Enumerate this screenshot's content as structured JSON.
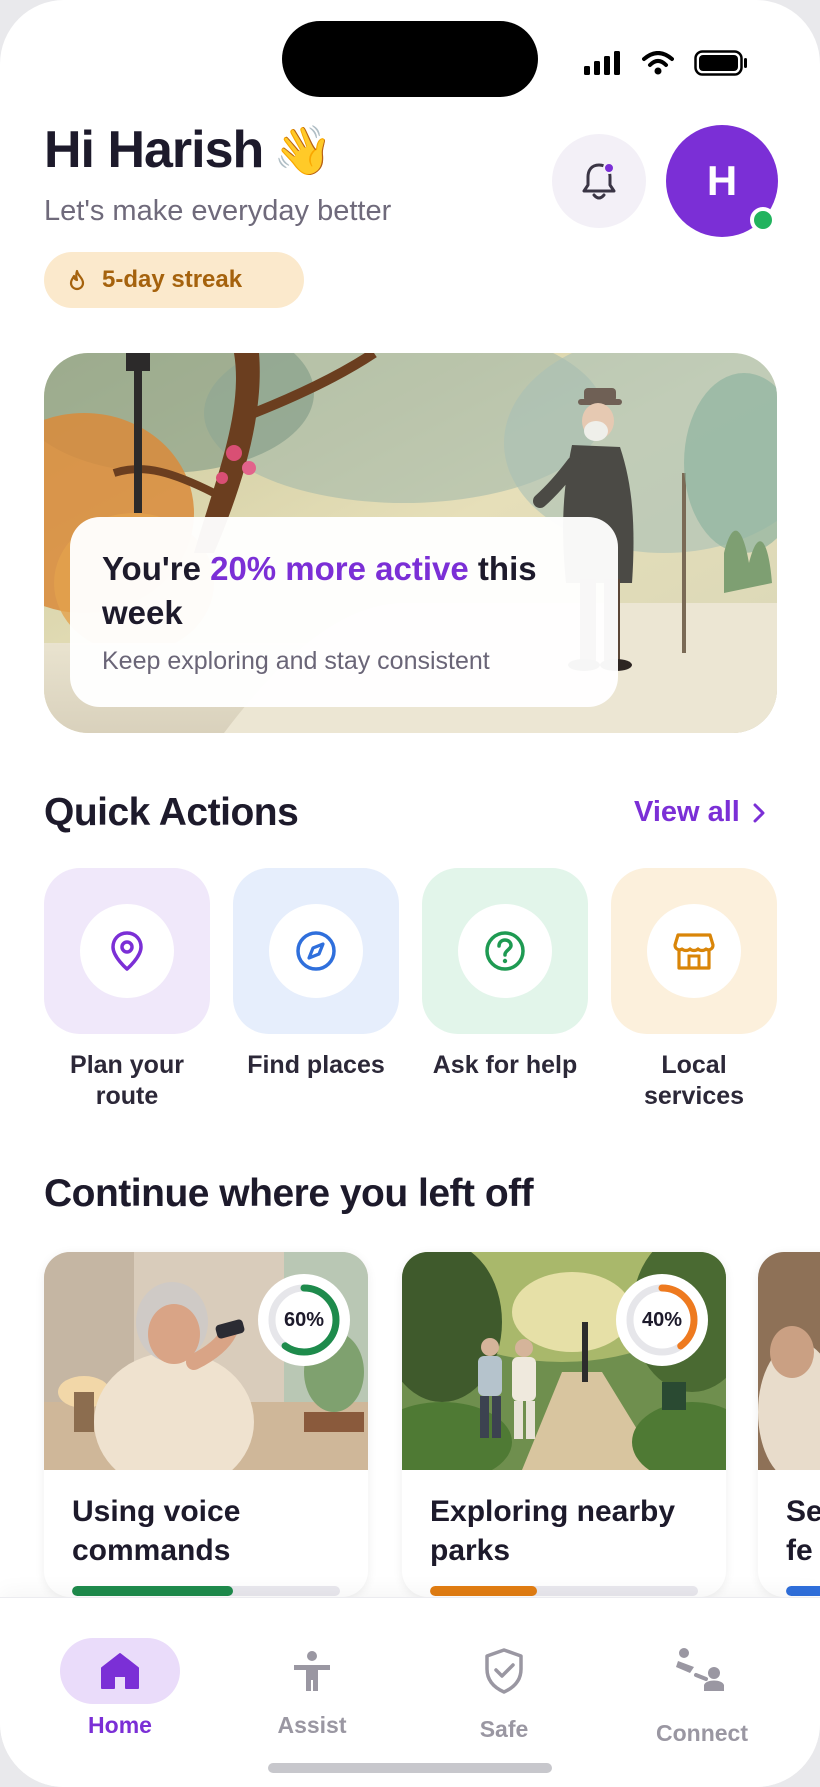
{
  "header": {
    "greeting": "Hi Harish",
    "wave_emoji": "👋",
    "subtitle": "Let's make everyday better",
    "streak_label": "5-day streak",
    "avatar_initial": "H"
  },
  "hero": {
    "title_prefix": "You're ",
    "title_accent": "20% more active",
    "title_suffix": " this week",
    "subtitle": "Keep exploring and stay consistent"
  },
  "quick_actions": {
    "title": "Quick Actions",
    "view_all": "View all",
    "items": [
      {
        "label": "Plan your route",
        "icon": "location-pin-icon",
        "tile_color": "#f0e8fa",
        "icon_color": "#7b2fd6"
      },
      {
        "label": "Find places",
        "icon": "compass-icon",
        "tile_color": "#e6eefc",
        "icon_color": "#2f6fdc"
      },
      {
        "label": "Ask for help",
        "icon": "question-icon",
        "tile_color": "#e2f5ea",
        "icon_color": "#1e9a52"
      },
      {
        "label": "Local services",
        "icon": "store-icon",
        "tile_color": "#fcf0dc",
        "icon_color": "#d98508"
      }
    ]
  },
  "continue": {
    "title": "Continue where you left off",
    "cards": [
      {
        "title": "Using voice commands",
        "progress": 60,
        "progress_label": "60%",
        "color": "#1e8b4c"
      },
      {
        "title": "Exploring nearby parks",
        "progress": 40,
        "progress_label": "40%",
        "color": "#ee7a1f"
      },
      {
        "title": "Se fe",
        "progress": 15,
        "progress_label": "",
        "color": "#2f6fdc"
      }
    ]
  },
  "nav": {
    "items": [
      {
        "label": "Home",
        "icon": "home-icon",
        "active": true
      },
      {
        "label": "Assist",
        "icon": "assist-person-icon",
        "active": false
      },
      {
        "label": "Safe",
        "icon": "shield-check-icon",
        "active": false
      },
      {
        "label": "Connect",
        "icon": "connect-people-icon",
        "active": false
      }
    ]
  },
  "colors": {
    "brand": "#7b2fd6",
    "online": "#22b35e",
    "streak_bg": "#fbe9cc",
    "streak_text": "#a5620d"
  }
}
